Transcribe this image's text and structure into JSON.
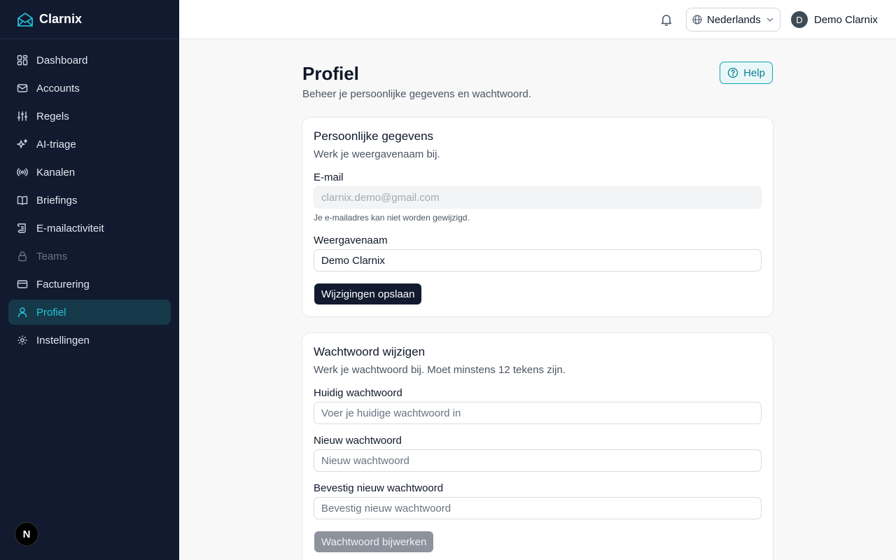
{
  "brand": {
    "name": "Clarnix",
    "logo_icon": "mail-open-icon",
    "accent": "#22b8cf"
  },
  "sidebar": {
    "items": [
      {
        "label": "Dashboard",
        "icon": "dashboard-icon"
      },
      {
        "label": "Accounts",
        "icon": "mail-icon"
      },
      {
        "label": "Regels",
        "icon": "sliders-icon"
      },
      {
        "label": "AI-triage",
        "icon": "sparkles-icon"
      },
      {
        "label": "Kanalen",
        "icon": "radio-icon"
      },
      {
        "label": "Briefings",
        "icon": "book-icon"
      },
      {
        "label": "E-mailactiviteit",
        "icon": "scroll-icon"
      },
      {
        "label": "Teams",
        "icon": "lock-icon",
        "state": "disabled"
      },
      {
        "label": "Facturering",
        "icon": "credit-card-icon"
      },
      {
        "label": "Profiel",
        "icon": "user-icon",
        "state": "active"
      },
      {
        "label": "Instellingen",
        "icon": "gear-icon"
      }
    ],
    "badge": "N"
  },
  "header": {
    "language": "Nederlands",
    "user_initial": "D",
    "user_name": "Demo Clarnix"
  },
  "main": {
    "title": "Profiel",
    "subtitle": "Beheer je persoonlijke gegevens en wachtwoord.",
    "help_label": "Help",
    "personal": {
      "title": "Persoonlijke gegevens",
      "subtitle": "Werk je weergavenaam bij.",
      "email_label": "E-mail",
      "email_value": "clarnix.demo@gmail.com",
      "email_hint": "Je e-mailadres kan niet worden gewijzigd.",
      "display_name_label": "Weergavenaam",
      "display_name_value": "Demo Clarnix",
      "save_label": "Wijzigingen opslaan"
    },
    "password": {
      "title": "Wachtwoord wijzigen",
      "subtitle": "Werk je wachtwoord bij. Moet minstens 12 tekens zijn.",
      "current_label": "Huidig wachtwoord",
      "current_placeholder": "Voer je huidige wachtwoord in",
      "new_label": "Nieuw wachtwoord",
      "new_placeholder": "Nieuw wachtwoord",
      "confirm_label": "Bevestig nieuw wachtwoord",
      "confirm_placeholder": "Bevestig nieuw wachtwoord",
      "update_label": "Wachtwoord bijwerken"
    }
  }
}
